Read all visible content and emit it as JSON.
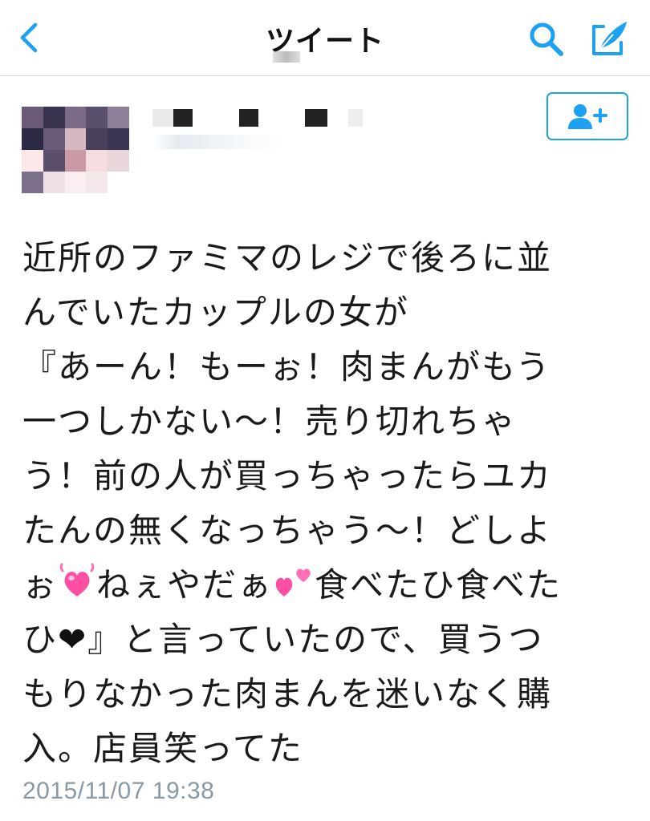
{
  "navbar": {
    "title": "ツイート",
    "back_icon": "chevron-left-icon",
    "search_icon": "search-icon",
    "compose_icon": "compose-tweet-icon"
  },
  "author": {
    "avatar_icon": "avatar",
    "follow_icon": "add-user-icon"
  },
  "tweet": {
    "lines": [
      "近所のファミマのレジで後ろに並",
      "んでいたカップルの女が",
      "『あーん！もーぉ！肉まんがもう",
      "一つしかない〜！売り切れちゃ",
      "う！前の人が買っちゃったらユカ",
      "たんの無くなっちゃう〜！どしよ",
      {
        "before": "ぉ",
        "heart1": "💓",
        "middle": "ねぇやだぁ",
        "heart2": "💕",
        "after": "食べたひ食べた"
      },
      {
        "before": "ひ",
        "heart": "❤",
        "after": "』と言っていたので、買うつ"
      },
      "もりなかった肉まんを迷いなく購",
      "入。店員笑ってた"
    ],
    "timestamp": "2015/11/07 19:38"
  },
  "colors": {
    "accent": "#1da1f2",
    "text": "#1a1a1a",
    "muted": "#8899a6",
    "heart_pink": "#ff4fa3"
  }
}
